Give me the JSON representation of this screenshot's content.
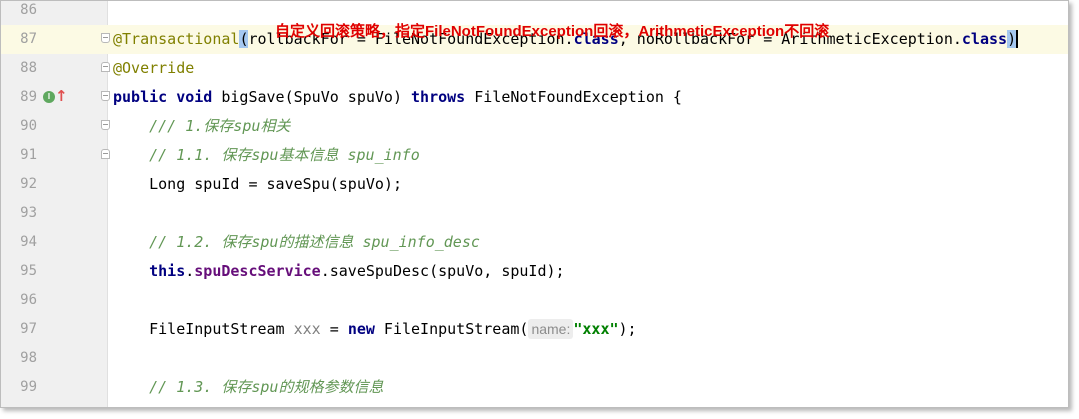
{
  "annotation": "自定义回滚策略，指定FileNotFoundException回滚，ArithmeticException不回滚",
  "lines": [
    {
      "num": "86"
    },
    {
      "num": "87",
      "parts": [
        {
          "t": "@Transactional",
          "c": "ann"
        },
        {
          "t": "(",
          "c": "bm"
        },
        {
          "t": "rollbackFor = FileNotFoundException."
        },
        {
          "t": "class",
          "c": "kw"
        },
        {
          "t": ", noRollbackFor = ArithmeticException."
        },
        {
          "t": "class",
          "c": "kw"
        },
        {
          "t": ")",
          "c": "bm cursor"
        }
      ]
    },
    {
      "num": "88",
      "parts": [
        {
          "t": "@Override",
          "c": "ann"
        }
      ]
    },
    {
      "num": "89",
      "parts": [
        {
          "t": "public void",
          "c": "kw"
        },
        {
          "t": " bigSave(SpuVo spuVo) "
        },
        {
          "t": "throws",
          "c": "kw"
        },
        {
          "t": " FileNotFoundException {"
        }
      ]
    },
    {
      "num": "90",
      "parts": [
        {
          "t": "    /// 1.保存spu相关",
          "c": "cmt"
        }
      ]
    },
    {
      "num": "91",
      "parts": [
        {
          "t": "    // 1.1. 保存spu基本信息 spu_info",
          "c": "cmt"
        }
      ]
    },
    {
      "num": "92",
      "parts": [
        {
          "t": "    Long spuId = saveSpu(spuVo);"
        }
      ]
    },
    {
      "num": "93"
    },
    {
      "num": "94",
      "parts": [
        {
          "t": "    // 1.2. 保存spu的描述信息 spu_info_desc",
          "c": "cmt"
        }
      ]
    },
    {
      "num": "95",
      "parts": [
        {
          "t": "    "
        },
        {
          "t": "this",
          "c": "kw"
        },
        {
          "t": "."
        },
        {
          "t": "spuDescService",
          "c": "fld"
        },
        {
          "t": ".saveSpuDesc(spuVo, spuId);"
        }
      ]
    },
    {
      "num": "96"
    },
    {
      "num": "97",
      "parts": [
        {
          "t": "    FileInputStream "
        },
        {
          "t": "xxx",
          "c": "gray"
        },
        {
          "t": " = "
        },
        {
          "t": "new",
          "c": "kw"
        },
        {
          "t": " FileInputStream("
        },
        {
          "t": "name:",
          "c": "hint"
        },
        {
          "t": "\"xxx\"",
          "c": "str"
        },
        {
          "t": ");"
        }
      ]
    },
    {
      "num": "98"
    },
    {
      "num": "99",
      "parts": [
        {
          "t": "    // 1.3. 保存spu的规格参数信息",
          "c": "cmt"
        }
      ]
    }
  ],
  "gutter_icons": {
    "line_89": [
      "implements-icon",
      "override-arrow-icon"
    ],
    "implements_glyph": "I",
    "arrow_glyph": "↑"
  },
  "colors": {
    "keyword": "#000080",
    "annotation": "#808000",
    "comment": "#629755",
    "field": "#660e7a",
    "string": "#008000",
    "overlay_text": "#e00000",
    "current_line": "#fcfae4",
    "brace_match": "#a5c8f0"
  }
}
